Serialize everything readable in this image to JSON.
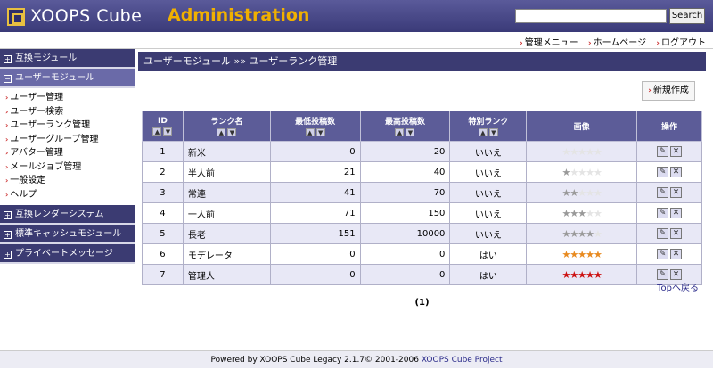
{
  "header": {
    "logo": "XOOPS Cube",
    "admin": "Administration",
    "search_button": "Search",
    "search_value": ""
  },
  "topnav": [
    {
      "label": "管理メニュー"
    },
    {
      "label": "ホームページ"
    },
    {
      "label": "ログアウト"
    }
  ],
  "sidebar": {
    "sections": [
      {
        "label": "互換モジュール",
        "icon": "+"
      },
      {
        "label": "ユーザーモジュール",
        "icon": "−"
      },
      {
        "label": "互換レンダーシステム",
        "icon": "+"
      },
      {
        "label": "標準キャッシュモジュール",
        "icon": "+"
      },
      {
        "label": "プライベートメッセージ",
        "icon": "+"
      }
    ],
    "user_items": [
      {
        "label": "ユーザー管理"
      },
      {
        "label": "ユーザー検索"
      },
      {
        "label": "ユーザーランク管理"
      },
      {
        "label": "ユーザーグループ管理"
      },
      {
        "label": "アバター管理"
      },
      {
        "label": "メールジョブ管理"
      },
      {
        "label": "一般設定"
      },
      {
        "label": "ヘルプ"
      }
    ]
  },
  "main": {
    "breadcrumb": "ユーザーモジュール »» ユーザーランク管理",
    "new_button": "新規作成",
    "columns": [
      "ID",
      "ランク名",
      "最低投稿数",
      "最高投稿数",
      "特別ランク",
      "画像",
      "操作"
    ],
    "rows": [
      {
        "id": "1",
        "name": "新米",
        "min": "0",
        "max": "20",
        "special": "いいえ",
        "stars": 0,
        "star_color": "#cccccc"
      },
      {
        "id": "2",
        "name": "半人前",
        "min": "21",
        "max": "40",
        "special": "いいえ",
        "stars": 1,
        "star_color": "#999999"
      },
      {
        "id": "3",
        "name": "常連",
        "min": "41",
        "max": "70",
        "special": "いいえ",
        "stars": 2,
        "star_color": "#999999"
      },
      {
        "id": "4",
        "name": "一人前",
        "min": "71",
        "max": "150",
        "special": "いいえ",
        "stars": 3,
        "star_color": "#999999"
      },
      {
        "id": "5",
        "name": "長老",
        "min": "151",
        "max": "10000",
        "special": "いいえ",
        "stars": 4,
        "star_color": "#999999"
      },
      {
        "id": "6",
        "name": "モデレータ",
        "min": "0",
        "max": "0",
        "special": "はい",
        "stars": 5,
        "star_color": "#e88a20"
      },
      {
        "id": "7",
        "name": "管理人",
        "min": "0",
        "max": "0",
        "special": "はい",
        "stars": 5,
        "star_color": "#cc1010"
      }
    ],
    "pager": "(1)",
    "top_link": "Topへ戻る"
  },
  "footer": {
    "text": "Powered by XOOPS Cube Legacy 2.1.7© 2001-2006 ",
    "link": "XOOPS Cube Project"
  }
}
